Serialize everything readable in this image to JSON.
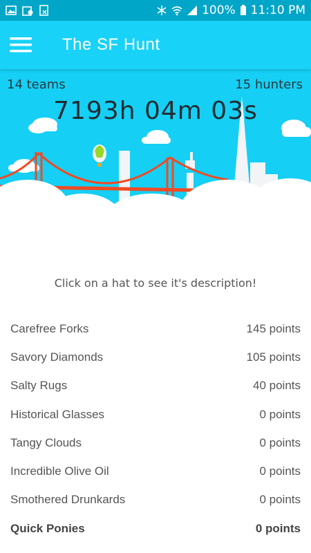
{
  "status_bar": {
    "battery": "100%",
    "time": "11:10 PM",
    "icons": [
      "gallery-icon",
      "calendar-icon",
      "bluetooth-muted-icon",
      "wifi-icon",
      "signal-icon",
      "battery-icon"
    ]
  },
  "app_bar": {
    "title": "The SF Hunt",
    "menu_icon": "hamburger-menu-icon"
  },
  "hero": {
    "teams": "14 teams",
    "hunters": "15 hunters",
    "timer": "7193h 04m 03s"
  },
  "hint": "Click on a hat to see it's description!",
  "teams": [
    {
      "name": "Carefree Forks",
      "points": "145 points"
    },
    {
      "name": "Savory Diamonds",
      "points": "105 points"
    },
    {
      "name": "Salty Rugs",
      "points": "40 points"
    },
    {
      "name": "Historical Glasses",
      "points": "0 points"
    },
    {
      "name": "Tangy Clouds",
      "points": "0 points"
    },
    {
      "name": "Incredible Olive Oil",
      "points": "0 points"
    },
    {
      "name": "Smothered Drunkards",
      "points": "0 points"
    },
    {
      "name": "Quick Ponies",
      "points": "0 points"
    }
  ],
  "colors": {
    "status_bar": "#00a6c8",
    "app_bar": "#18d2f7",
    "sky": "#15cff5",
    "bridge": "#f04a23"
  }
}
